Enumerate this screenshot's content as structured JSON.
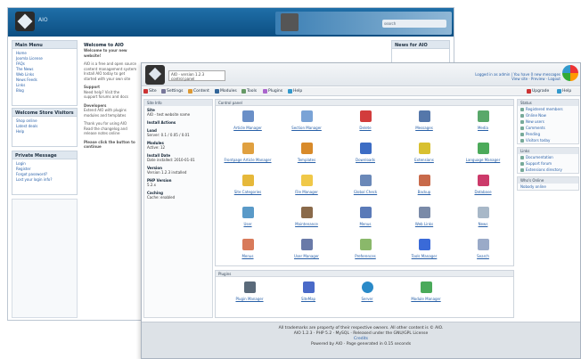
{
  "back": {
    "brand": "AIO",
    "search": "search",
    "main_menu": "Main Menu",
    "menu_links": [
      "Home",
      "Joomla License",
      "FAQs",
      "The News",
      "Web Links",
      "News Feeds",
      "Links",
      "Blog"
    ],
    "welcome_title": "Welcome to AIO",
    "welcome_sub": "Welcome to your new website!",
    "welcome_lines": [
      "AIO is a free and open source",
      "content management system",
      "Install AIO today to get",
      "started with your own site"
    ],
    "section2_title": "Support",
    "section2_lines": [
      "Need help? Visit the",
      "support forums and docs"
    ],
    "section3_title": "Developers",
    "section3_lines": [
      "Extend AIO with plugins",
      "modules and templates"
    ],
    "section4_lines": [
      "Thank you for using AIO",
      "Read the changelog and",
      "release notes online"
    ],
    "footnote": "Please click the button to continue",
    "news_title": "News for AIO",
    "who_title": "Welcome Store Visitors",
    "who_links": [
      "Shop online",
      "Latest deals",
      "Help"
    ],
    "login_title": "Private Message",
    "login_links": [
      "Login",
      "Register",
      "Forgot password?",
      "Lost your login info?"
    ]
  },
  "front": {
    "brand_line1": "AIO - version 1.2.3",
    "brand_line2": "control panel",
    "loginfo_line1": "Logged in as admin | You have 0 new messages",
    "loginfo_line2": "View site · Preview · Logout",
    "menus": [
      "Site",
      "Settings",
      "Content",
      "Modules",
      "Tools",
      "Plugins",
      "Help"
    ],
    "menus_right": [
      "Upgrade",
      "Help"
    ],
    "col1_header": "Site Info",
    "col1_items": [
      {
        "title": "Site",
        "text": "AIO - test website name"
      },
      {
        "title": "Install Actions",
        "text": ""
      },
      {
        "title": "Load",
        "text": "Server: 0.1 / 0.05 / 0.01"
      },
      {
        "title": "Modules",
        "text": "Active: 12"
      },
      {
        "title": "Install Date",
        "text": "Date installed: 2010-01-01"
      },
      {
        "title": "Version",
        "text": "Version 1.2.3 installed"
      },
      {
        "title": "PHP Version",
        "text": "5.2.x"
      },
      {
        "title": "Caching",
        "text": "Cache: enabled"
      }
    ],
    "cpanel_header": "Control panel",
    "tiles": [
      "Article Manager",
      "Section Manager",
      "Delete",
      "Messages",
      "Media",
      "Frontpage Article Manager",
      "Templates",
      "Downloads",
      "Extensions",
      "Language Manager",
      "Site Categories",
      "File Manager",
      "Global Check",
      "Backup",
      "Database",
      "User",
      "Maintenance",
      "Menus",
      "Web Links",
      "News",
      "Menus",
      "User Manager",
      "Preferences",
      "Tools Manager",
      "Search",
      "System Info",
      "Plugin Manager",
      "Mail Manager",
      "Server",
      "Module Manager"
    ],
    "plugins_header": "Plugins",
    "plugins": [
      "Plugin Manager",
      "SiteMap",
      "Server",
      "Module Manager"
    ],
    "col3_header1": "Status",
    "col3_items1": [
      "Registered members",
      "Online Now",
      "New users",
      "Comments",
      "Pending",
      "Visitors today"
    ],
    "col3_header2": "Links",
    "col3_items2": [
      "Documentation",
      "Support forum",
      "Extensions directory"
    ],
    "col3_header3": "Who's Online",
    "col3_items3": [
      "Nobody online"
    ],
    "footer_line1": "All trademarks are property of their respective owners. All other content is © AIO.",
    "footer_line2": "AIO 1.2.3 · PHP 5.2 · MySQL · Released under the GNU/GPL License",
    "footer_link": "Credits",
    "footer_line3": "Powered by AIO · Page generated in 0.15 seconds"
  }
}
